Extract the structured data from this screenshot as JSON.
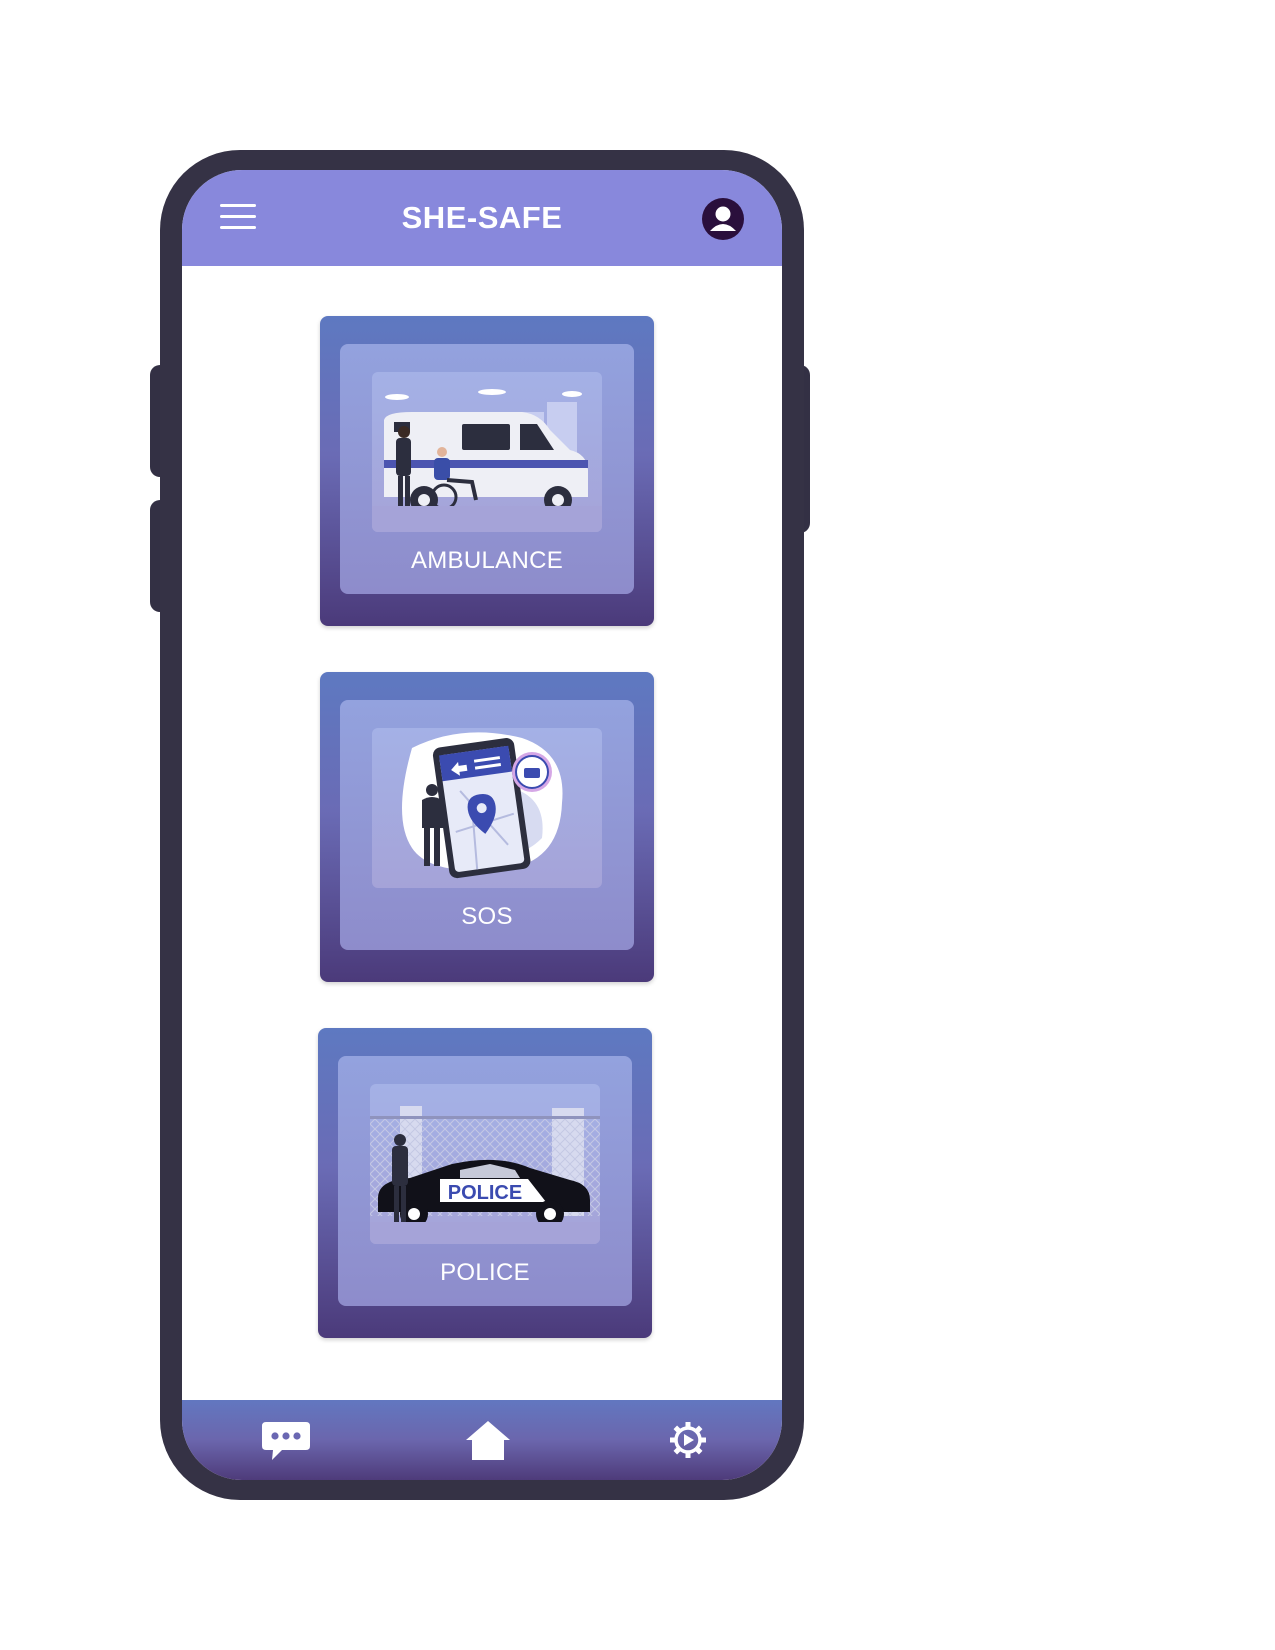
{
  "header": {
    "title": "SHE-SAFE",
    "menu_icon": "hamburger-menu-icon",
    "profile_icon": "user-avatar-icon"
  },
  "services": [
    {
      "label": "AMBULANCE",
      "illustration": "ambulance-illustration"
    },
    {
      "label": "SOS",
      "illustration": "sos-phone-location-illustration"
    },
    {
      "label": "POLICE",
      "illustration": "police-car-illustration"
    }
  ],
  "bottom_nav": [
    {
      "icon": "chat-icon"
    },
    {
      "icon": "home-icon"
    },
    {
      "icon": "settings-icon"
    }
  ],
  "colors": {
    "header": "#8888dc",
    "phone_frame": "#353245",
    "card_gradient_top": "#5e79c1",
    "card_gradient_bottom": "#4b3a7a",
    "text": "#ffffff"
  }
}
